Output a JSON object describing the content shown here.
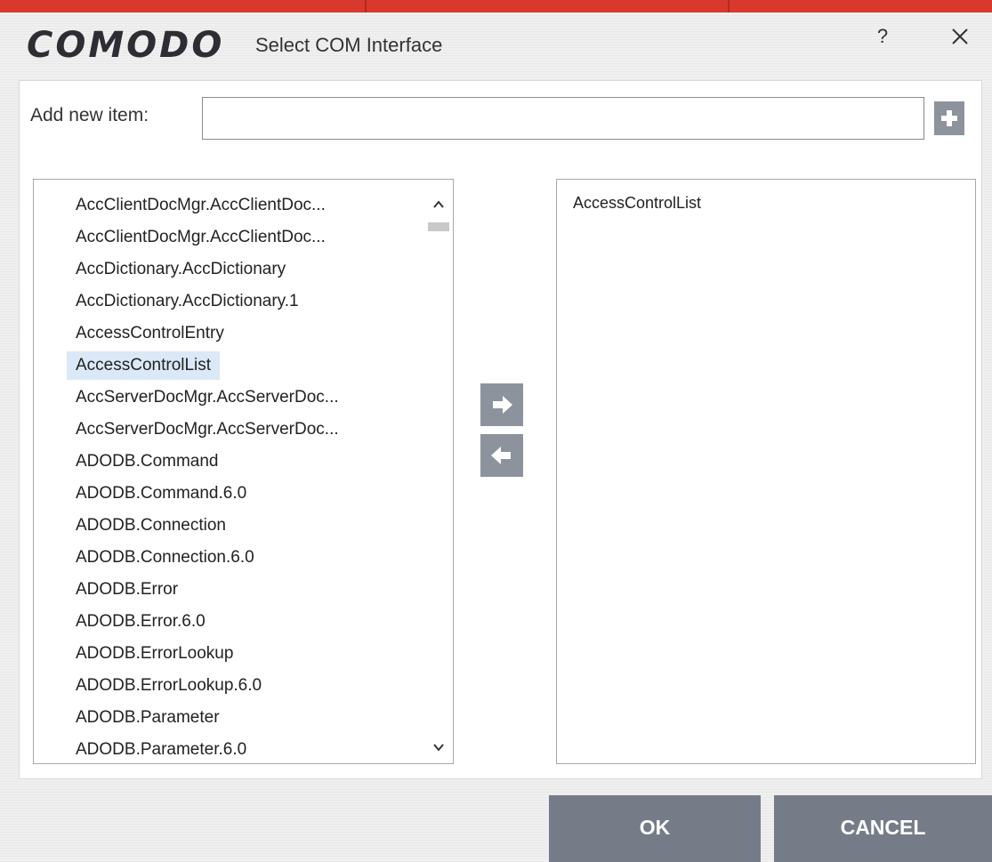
{
  "window": {
    "logo": "COMODO",
    "title": "Select COM Interface",
    "help_label": "?",
    "close_icon": "close-icon"
  },
  "add_item": {
    "label": "Add new item:",
    "value": "",
    "placeholder": "",
    "add_icon": "plus-icon"
  },
  "available_list": {
    "items": [
      "AccClientDocMgr.AccClientDoc...",
      "AccClientDocMgr.AccClientDoc...",
      "AccDictionary.AccDictionary",
      "AccDictionary.AccDictionary.1",
      "AccessControlEntry",
      "AccessControlList",
      "AccServerDocMgr.AccServerDoc...",
      "AccServerDocMgr.AccServerDoc...",
      "ADODB.Command",
      "ADODB.Command.6.0",
      "ADODB.Connection",
      "ADODB.Connection.6.0",
      "ADODB.Error",
      "ADODB.Error.6.0",
      "ADODB.ErrorLookup",
      "ADODB.ErrorLookup.6.0",
      "ADODB.Parameter",
      "ADODB.Parameter.6.0"
    ],
    "selected_item": "AccessControlList"
  },
  "transfer": {
    "add_icon": "arrow-right-icon",
    "remove_icon": "arrow-left-icon"
  },
  "selected_list": {
    "items": [
      "AccessControlList"
    ]
  },
  "footer": {
    "ok_label": "OK",
    "cancel_label": "CANCEL"
  },
  "colors": {
    "accent_red": "#d8392c",
    "button_gray": "#767c87",
    "icon_button_gray": "#8d939c",
    "selection_blue": "#dbe8f7"
  }
}
